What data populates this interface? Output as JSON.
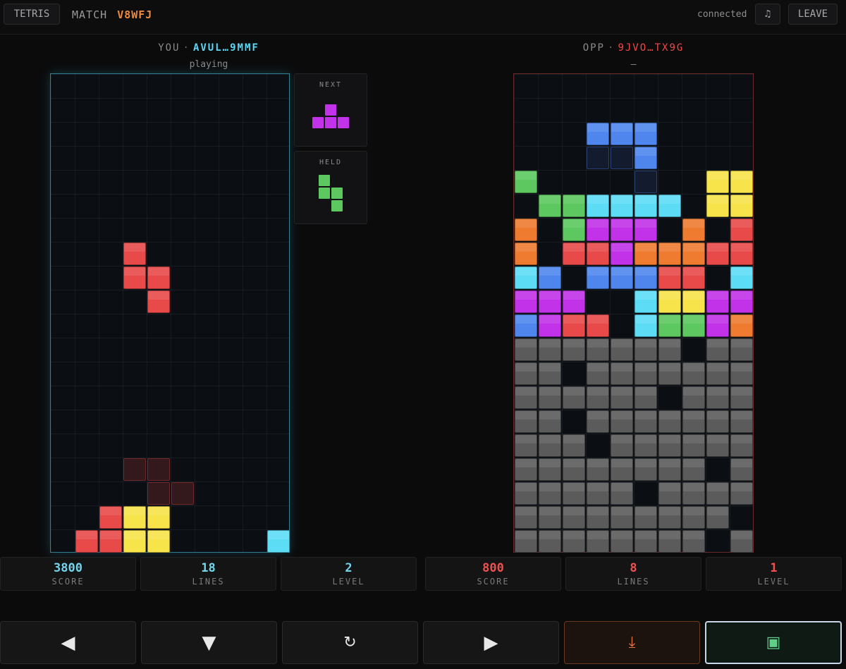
{
  "topbar": {
    "app_button": "TETRIS",
    "match_label": "MATCH",
    "match_code": "V8WFJ",
    "connection_status": "connected",
    "music_icon": "♫",
    "leave_button": "LEAVE"
  },
  "player": {
    "label": "YOU",
    "separator": "·",
    "id": "AVUL…9MMF",
    "status": "playing",
    "stats": [
      {
        "value": "3800",
        "label": "SCORE"
      },
      {
        "value": "18",
        "label": "LINES"
      },
      {
        "value": "2",
        "label": "LEVEL"
      }
    ]
  },
  "opponent": {
    "label": "OPP",
    "separator": "·",
    "id": "9JVO…TX9G",
    "status": "–",
    "stats": [
      {
        "value": "800",
        "label": "SCORE"
      },
      {
        "value": "8",
        "label": "LINES"
      },
      {
        "value": "1",
        "label": "LEVEL"
      }
    ]
  },
  "next_box": {
    "title": "NEXT",
    "piece": "T"
  },
  "held_box": {
    "title": "HELD",
    "piece": "S"
  },
  "colors": {
    "I": "#5ddcf5",
    "O": "#f7e44a",
    "T": "#c132e8",
    "S": "#5cc85f",
    "Z": "#e84a4a",
    "J": "#4f86ee",
    "L": "#ee7b30",
    "G": "#5b5b5b",
    "accent_you": "#5ad8f5",
    "accent_opp": "#f04848",
    "match_code": "#f08a3c"
  },
  "your_board": {
    "active_piece": {
      "type": "Z",
      "cells": [
        [
          3,
          7
        ],
        [
          3,
          8
        ],
        [
          4,
          8
        ],
        [
          4,
          9
        ]
      ]
    },
    "ghost_piece": {
      "type": "Z",
      "cells": [
        [
          3,
          16
        ],
        [
          4,
          16
        ],
        [
          4,
          17
        ],
        [
          5,
          17
        ]
      ]
    },
    "locked": [
      {
        "x": 2,
        "y": 18,
        "c": "Z"
      },
      {
        "x": 3,
        "y": 18,
        "c": "O"
      },
      {
        "x": 4,
        "y": 18,
        "c": "O"
      },
      {
        "x": 1,
        "y": 19,
        "c": "Z"
      },
      {
        "x": 2,
        "y": 19,
        "c": "Z"
      },
      {
        "x": 3,
        "y": 19,
        "c": "O"
      },
      {
        "x": 4,
        "y": 19,
        "c": "O"
      },
      {
        "x": 9,
        "y": 19,
        "c": "I"
      }
    ]
  },
  "opponent_board": {
    "ghost_piece": {
      "type": "J",
      "cells": [
        [
          3,
          3
        ],
        [
          4,
          3
        ],
        [
          5,
          3
        ],
        [
          5,
          4
        ]
      ]
    },
    "rows": [
      "..........",
      "..........",
      "...JJJ....",
      ".....J....",
      "S.......OO",
      ".SSIIII.OO",
      "L.STTT.L.Z",
      "L.ZZTLLLZZ",
      "IJ.JJJZZ.I",
      "TTT..IOOTT",
      "JTZZ.ISSTL",
      "GGGGGGG.GG",
      "GG.GGGGGGG",
      "GGGGGG.GGG",
      "GG.GGGGGGG",
      "GGG.GGGGGG",
      "GGGGGGGG.G",
      "GGGGG.GGGG",
      "GGGGGGGGG.",
      "GGGGGGGG.G"
    ]
  },
  "controls": [
    {
      "name": "move-left-button",
      "icon": "◀",
      "icon_name": "left-arrow-icon"
    },
    {
      "name": "soft-drop-button",
      "icon": "▼",
      "icon_name": "down-arrow-icon"
    },
    {
      "name": "rotate-button",
      "icon": "↻",
      "icon_name": "rotate-icon"
    },
    {
      "name": "move-right-button",
      "icon": "▶",
      "icon_name": "right-arrow-icon"
    },
    {
      "name": "hard-drop-button",
      "icon": "⤓",
      "icon_name": "hard-drop-icon"
    },
    {
      "name": "hold-button",
      "icon": "▣",
      "icon_name": "hold-icon"
    }
  ]
}
